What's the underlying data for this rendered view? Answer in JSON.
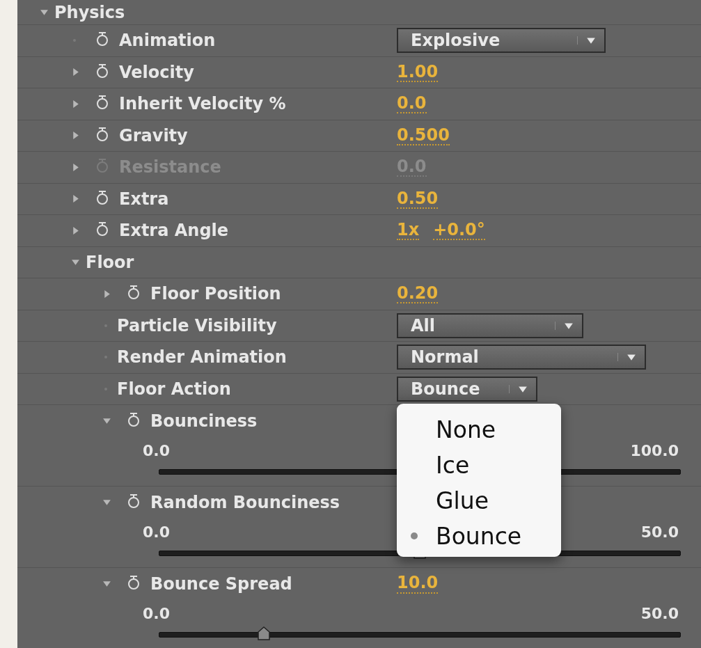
{
  "section": {
    "label": "Physics",
    "expanded": true,
    "children": [
      {
        "kind": "dropdown",
        "label": "Animation",
        "stopwatch": true,
        "disabled": false,
        "value": "Explosive"
      },
      {
        "kind": "number",
        "label": "Velocity",
        "stopwatch": true,
        "expanded": false,
        "disabled": false,
        "values": [
          "1.00"
        ]
      },
      {
        "kind": "number",
        "label": "Inherit Velocity %",
        "stopwatch": true,
        "expanded": false,
        "disabled": false,
        "values": [
          "0.0"
        ]
      },
      {
        "kind": "number",
        "label": "Gravity",
        "stopwatch": true,
        "expanded": false,
        "disabled": false,
        "values": [
          "0.500"
        ]
      },
      {
        "kind": "number",
        "label": "Resistance",
        "stopwatch": true,
        "expanded": false,
        "disabled": true,
        "values": [
          "0.0"
        ]
      },
      {
        "kind": "number",
        "label": "Extra",
        "stopwatch": true,
        "expanded": false,
        "disabled": false,
        "values": [
          "0.50"
        ]
      },
      {
        "kind": "number",
        "label": "Extra Angle",
        "stopwatch": true,
        "expanded": false,
        "disabled": false,
        "values": [
          "1x",
          "+0.0°"
        ]
      },
      {
        "kind": "group",
        "label": "Floor",
        "stopwatch": false,
        "expanded": true,
        "disabled": false,
        "children": [
          {
            "kind": "number",
            "label": "Floor Position",
            "stopwatch": true,
            "expanded": false,
            "disabled": false,
            "values": [
              "0.20"
            ]
          },
          {
            "kind": "dropdown",
            "label": "Particle Visibility",
            "stopwatch": false,
            "disabled": false,
            "value": "All"
          },
          {
            "kind": "dropdown",
            "label": "Render Animation",
            "stopwatch": false,
            "disabled": false,
            "value": "Normal"
          },
          {
            "kind": "dropdown",
            "label": "Floor Action",
            "stopwatch": false,
            "disabled": false,
            "value": "Bounce",
            "menu": [
              {
                "label": "None",
                "selected": false
              },
              {
                "label": "Ice",
                "selected": false
              },
              {
                "label": "Glue",
                "selected": false
              },
              {
                "label": "Bounce",
                "selected": true
              }
            ]
          },
          {
            "kind": "slider",
            "label": "Bounciness",
            "stopwatch": true,
            "expanded": true,
            "disabled": false,
            "min": "0.0",
            "max": "100.0"
          },
          {
            "kind": "slider",
            "label": "Random Bounciness",
            "stopwatch": true,
            "expanded": true,
            "disabled": false,
            "min": "0.0",
            "max": "50.0",
            "level": 0.5
          },
          {
            "kind": "slider",
            "label": "Bounce Spread",
            "stopwatch": true,
            "expanded": true,
            "disabled": false,
            "values": [
              "10.0"
            ],
            "min": "0.0",
            "max": "50.0",
            "level": 0.2
          }
        ]
      }
    ]
  }
}
